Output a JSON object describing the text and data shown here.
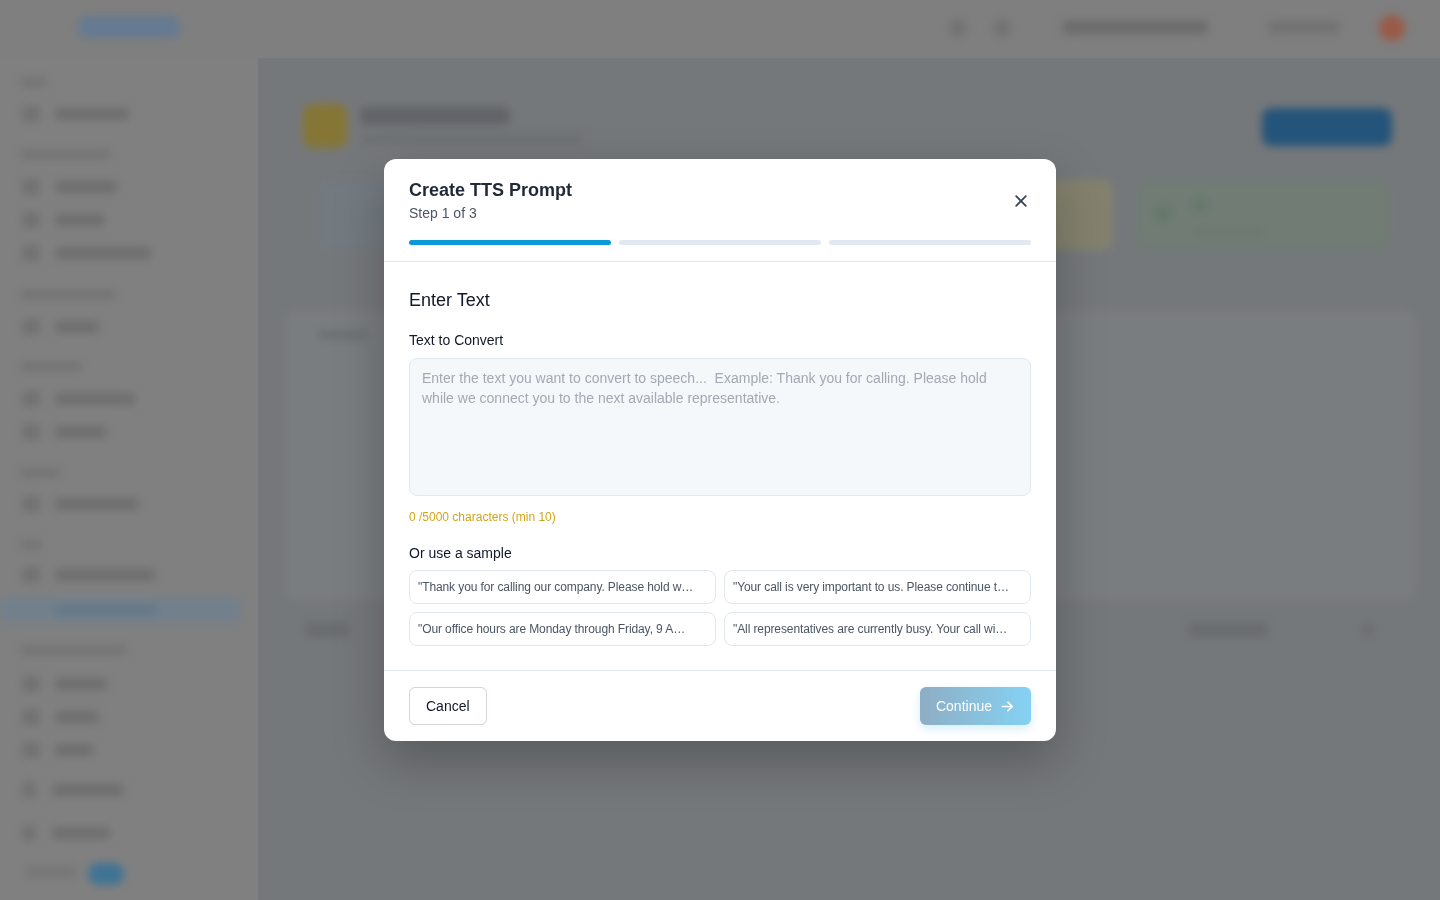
{
  "dialog": {
    "title": "Create TTS Prompt",
    "step_label": "Step 1 of 3",
    "progress": [
      {
        "done": true
      },
      {
        "done": false
      },
      {
        "done": false
      }
    ],
    "section_title": "Enter Text",
    "text_field": {
      "label": "Text to Convert",
      "placeholder": "Enter the text you want to convert to speech...  Example: Thank you for calling. Please hold while we connect you to the next available representative.",
      "counter": "0 /5000 characters (min 10)"
    },
    "samples": {
      "label": "Or use a sample",
      "items": [
        "\"Thank you for calling our company. Please hold w…",
        "\"Your call is very important to us. Please continue t…",
        "\"Our office hours are Monday through Friday, 9 A…",
        "\"All representatives are currently busy. Your call wi…"
      ]
    },
    "buttons": [
      {
        "kind": "secondary",
        "label": "Cancel",
        "disabled": false
      },
      {
        "kind": "primary",
        "label": "Continue",
        "disabled": true
      }
    ]
  }
}
